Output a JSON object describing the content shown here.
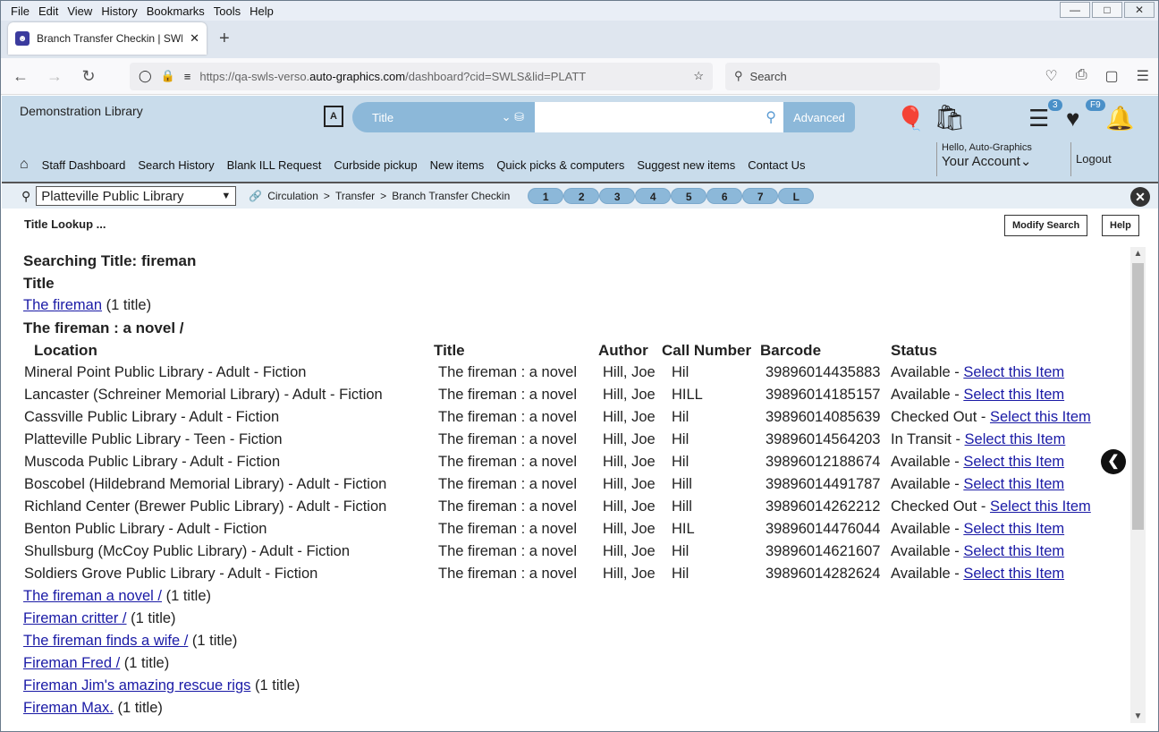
{
  "menu": [
    "File",
    "Edit",
    "View",
    "History",
    "Bookmarks",
    "Tools",
    "Help"
  ],
  "tab": {
    "title": "Branch Transfer Checkin | SWLS"
  },
  "url": {
    "prefix": "https://qa-swls-verso.",
    "domain": "auto-graphics.com",
    "path": "/dashboard?cid=SWLS&lid=PLATT"
  },
  "browser_search": {
    "placeholder": "Search"
  },
  "library": {
    "name": "Demonstration Library",
    "search_type": "Title",
    "advanced_label": "Advanced",
    "list_badge": "3",
    "fav_badge": "F9",
    "nav": [
      "Staff Dashboard",
      "Search History",
      "Blank ILL Request",
      "Curbside pickup",
      "New items",
      "Quick picks & computers",
      "Suggest new items",
      "Contact Us"
    ],
    "hello": "Hello, Auto-Graphics",
    "account": "Your Account",
    "logout": "Logout"
  },
  "crumb": {
    "branch": "Platteville Public Library",
    "path": [
      "Circulation",
      "Transfer",
      "Branch Transfer Checkin"
    ],
    "steps": [
      "1",
      "2",
      "3",
      "4",
      "5",
      "6",
      "7",
      "L"
    ]
  },
  "page": {
    "title": "Title Lookup ...",
    "modify_label": "Modify Search",
    "help_label": "Help"
  },
  "results": {
    "searching": "Searching Title: fireman",
    "title_heading": "Title",
    "first": {
      "link": "The fireman",
      "count": "(1 title)"
    },
    "group_heading": "The fireman : a novel /",
    "columns": [
      "Location",
      "Title",
      "Author",
      "Call Number",
      "Barcode",
      "Status"
    ],
    "items": [
      {
        "location": "Mineral Point Public Library - Adult - Fiction",
        "title": "The fireman : a novel",
        "author": "Hill, Joe",
        "call": "Hil",
        "barcode": "39896014435883",
        "status": "Available - ",
        "select": "Select this Item"
      },
      {
        "location": "Lancaster (Schreiner Memorial Library) - Adult - Fiction",
        "title": "The fireman : a novel",
        "author": "Hill, Joe",
        "call": "HILL",
        "barcode": "39896014185157",
        "status": "Available - ",
        "select": "Select this Item"
      },
      {
        "location": "Cassville Public Library - Adult - Fiction",
        "title": "The fireman : a novel",
        "author": "Hill, Joe",
        "call": "Hil",
        "barcode": "39896014085639",
        "status": "Checked Out - ",
        "select": "Select this Item"
      },
      {
        "location": "Platteville Public Library - Teen - Fiction",
        "title": "The fireman : a novel",
        "author": "Hill, Joe",
        "call": "Hil",
        "barcode": "39896014564203",
        "status": "In Transit - ",
        "select": "Select this Item"
      },
      {
        "location": "Muscoda Public Library - Adult - Fiction",
        "title": "The fireman : a novel",
        "author": "Hill, Joe",
        "call": "Hil",
        "barcode": "39896012188674",
        "status": "Available - ",
        "select": "Select this Item"
      },
      {
        "location": "Boscobel (Hildebrand Memorial Library) - Adult - Fiction",
        "title": "The fireman : a novel",
        "author": "Hill, Joe",
        "call": "Hill",
        "barcode": "39896014491787",
        "status": "Available - ",
        "select": "Select this Item"
      },
      {
        "location": "Richland Center (Brewer Public Library) - Adult - Fiction",
        "title": "The fireman : a novel",
        "author": "Hill, Joe",
        "call": "Hill",
        "barcode": "39896014262212",
        "status": "Checked Out - ",
        "select": "Select this Item"
      },
      {
        "location": "Benton Public Library - Adult - Fiction",
        "title": "The fireman : a novel",
        "author": "Hill, Joe",
        "call": "HIL",
        "barcode": "39896014476044",
        "status": "Available - ",
        "select": "Select this Item"
      },
      {
        "location": "Shullsburg (McCoy Public Library) - Adult - Fiction",
        "title": "The fireman : a novel",
        "author": "Hill, Joe",
        "call": "Hil",
        "barcode": "39896014621607",
        "status": "Available - ",
        "select": "Select this Item"
      },
      {
        "location": "Soldiers Grove Public Library - Adult - Fiction",
        "title": "The fireman : a novel",
        "author": "Hill, Joe",
        "call": "Hil",
        "barcode": "39896014282624",
        "status": "Available - ",
        "select": "Select this Item"
      }
    ],
    "more": [
      {
        "link": "The fireman a novel /",
        "count": "(1 title)"
      },
      {
        "link": "Fireman critter /",
        "count": "(1 title)"
      },
      {
        "link": "The fireman finds a wife /",
        "count": "(1 title)"
      },
      {
        "link": "Fireman Fred /",
        "count": "(1 title)"
      },
      {
        "link": "Fireman Jim's amazing rescue rigs",
        "count": "(1 title)"
      },
      {
        "link": "Fireman Max.",
        "count": "(1 title)"
      }
    ]
  },
  "icons": {
    "home": "home-icon",
    "balloon": "balloon-icon",
    "list": "list-icon",
    "heart": "heart-icon",
    "bell": "bell-icon"
  }
}
